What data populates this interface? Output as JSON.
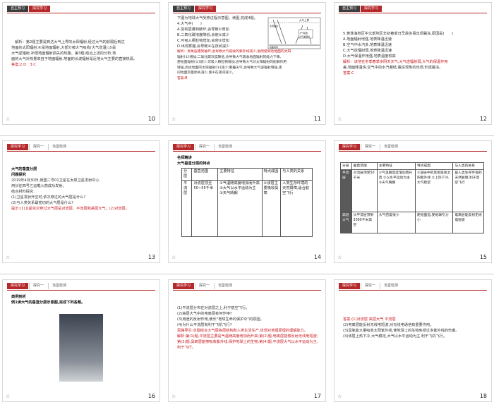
{
  "tabs": {
    "self": "自主预习",
    "explore": "探究学习",
    "explore2": "探究一",
    "explore3": "探究二",
    "explore4": "当堂检测"
  },
  "slides": [
    {
      "number": "10",
      "lines": [
        "解析：第2题主要是到达大气上界的太阳辐射,经过大气的削弱后到达",
        "地面的太阳辐射;④是地面辐射,大部分被大气吸收(大气增温);⑤是",
        "大气逆辐射,补偿地面辐射损失的热量。第3题,结合上述的分析,地",
        "面的大气对热量来自于地面辐射,地面的长波辐射是近地大气主要的直接热源。"
      ],
      "answer": "答案:2.D　3.C"
    },
    {
      "number": "11",
      "lines": [
        "下图为地球大气受热过程示意图。读图,完成4题。",
        "4.大气中(　　)",
        "A.臭氧层遭到破坏,会导致①增加",
        "B.二氧化碳浓度降低,会使②减少",
        "C.可吸入颗粒物增加,会使③增加",
        "D.出现雾霾,会导致④在夜间减少",
        "解析：臭氧层遭到破坏,会导致大气吸收的紫外线减少,进而使到达地面的太阳",
        "辐射(①)增加;二氧化碳浓度降低,会导致大气吸收地面辐射的能力下降,",
        "使地面辐射(②)减少;可吸入颗粒物增加,会导致大气对太阳辐射的削弱作用",
        "增强,到达地面的太阳辐射(③)减少;雾霾天气,会导致大气逆辐射增强,夜",
        "间地面热量损失减少,使④在夜间减少。"
      ],
      "answer": "答案:B",
      "diagram": {
        "labels": [
          "太阳辐射",
          "大气上界",
          "大气吸收",
          "大气逆辐射",
          "射向宇宙空间",
          "地面吸收"
        ]
      }
    },
    {
      "number": "12",
      "lines": [
        "5.黄淮海地区中北部地区年初春季日早晨多易出现霜冻,原因是(　　)",
        "A.地面辐射增强,地表降温迅速",
        "B.空气中水汽多,地表降温迅速",
        "C.大气逆辐射弱,地表降温迅速",
        "D.大气保温作用强,地表温度较高",
        "解析：该地在冬季春季多阴天天气,大气逆辐射弱,大气的保温作用",
        "差,地面降温快,空气中的水汽凝结,霜冻现象的出现,形成霜冻。"
      ],
      "answer": "答案:C"
    },
    {
      "number": "13",
      "heading": "大气的垂直分层",
      "subheading": "问题探究",
      "lines": [
        "2019年4月30日,我国二号01卫星在太原卫星发射中心",
        "用长征四号乙运载火箭成功发射。",
        "结合材料探究:",
        "(1)卫星发射升空时,依次穿过的大气层是什么?",
        "(2)与人类关系最密切的大气层是什么?"
      ],
      "hint": "提示:(1)卫星依次穿过大气层是对流层、平流层和高层大气。(2)对流层。"
    },
    {
      "number": "14",
      "heading": "名师精讲",
      "subheading": "大气垂直分层的特点",
      "table": {
        "headers": [
          "分层",
          "垂直范围",
          "主要特征",
          "特点成因",
          "与人类的关系"
        ],
        "rows": [
          [
            "平流层",
            "对流层顶至50~55千米",
            "①气温随高度增加而升高 ②大气以水平运动为主 ③天气晴朗",
            "①该层主要吸收臭氧",
            "大量紫外线 ②低层气温...",
            "人类生存环境的天然屏障,适合航空飞行"
          ]
        ]
      }
    },
    {
      "number": "15",
      "table": {
        "headers": [
          "分层",
          "垂直范围",
          "主要特征",
          "特点成因",
          "与人类的关系"
        ],
        "rows": [
          [
            "平流层",
            "对流层顶至50千米",
            "①气温随高度增加而升高 ②以水平运动为主 ③天气晴朗",
            "①该层中的臭氧吸收太阳紫外线 ②上热下冷,大气稳定",
            "是人类生存环境的天然屏障,利于高空飞行"
          ],
          [
            "高层大气",
            "从平流层顶到3000千米高空",
            "大气密度很小",
            "距地面远,受地球引力小",
            "电离层能反射无线电短波"
          ]
        ]
      }
    },
    {
      "number": "16",
      "heading": "典例剖析",
      "subheading": "例1读大气的垂直分层示意图,完成下列各题。"
    },
    {
      "number": "17",
      "lines": [
        "(1)平流层分布在对流层之上,利于航空飞行。",
        "(2)高层大气中的电离层有何作用?",
        "(3)用途的反射作用,使长\"地球生命的保护伞\"的原因。",
        "(4)为什么平流层有利于飞机飞行?"
      ],
      "guide": "思路导引:本题结合大气层各层结构和人类生活生产,体现对地理原理的理解能力。",
      "analysis": "解析:第(1)题,平流层主要是气温随高度增加而升高;第(2)题,电离层能够反射无线电短波;第(3)题,臭氧层能够吸收紫外线,保护地球上的生物;第(4)题,平流层大气以水平运动为主,利于飞行。"
    },
    {
      "number": "18",
      "answer": "答案:(1)对流层 高层大气 平流层",
      "lines": [
        "(2)电离层能反射无线电短波,对无线电通信有重要作用。",
        "(3)臭氧能大量吸收太阳紫外线,使地球上的生物免受过多紫外线的伤害。",
        "(4)该层上热下冷,大气稳定,大气以水平运动为主,利于飞机飞行。"
      ]
    }
  ]
}
